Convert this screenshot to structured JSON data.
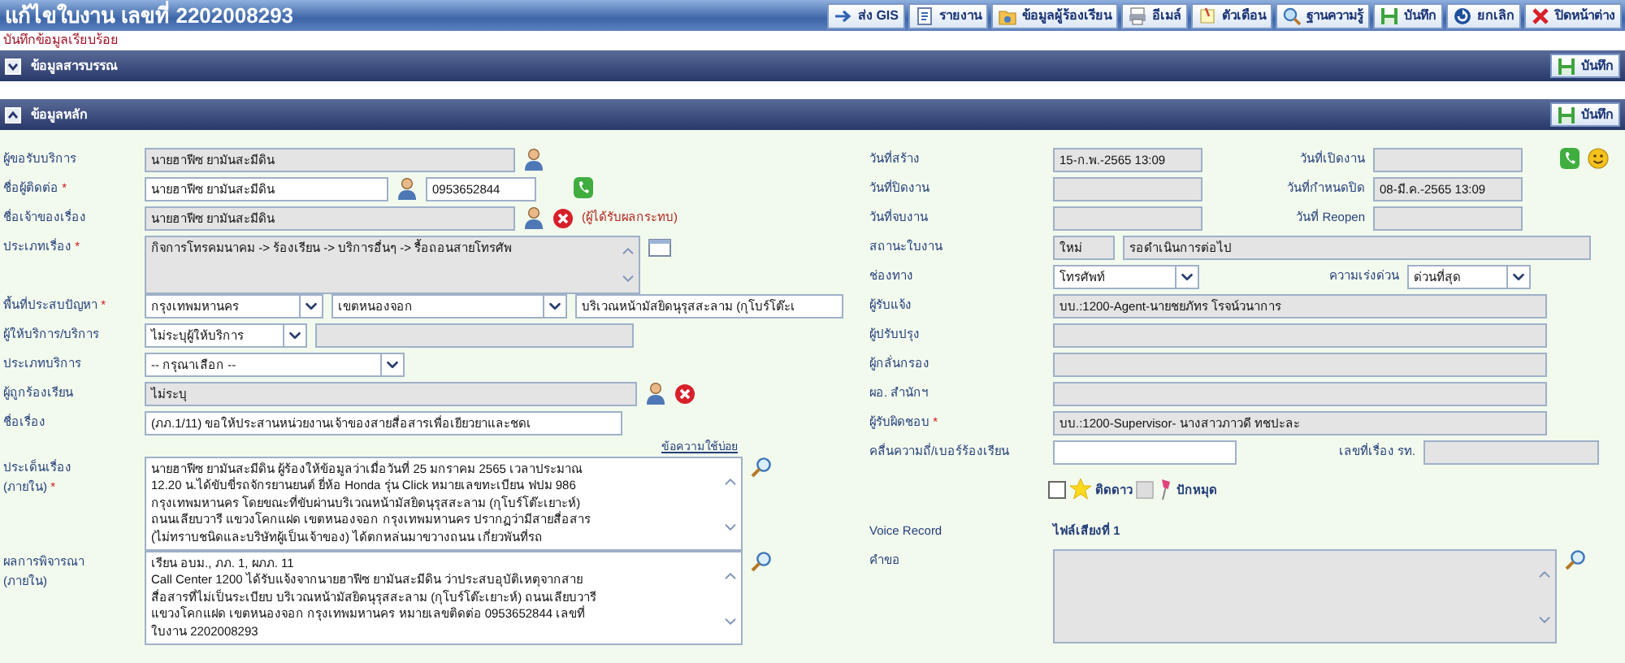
{
  "window": {
    "title": "แก้ไขใบงาน เลขที่ 2202008293"
  },
  "toolbar": [
    "ส่ง GIS",
    "รายงาน",
    "ข้อมูลผู้ร้องเรียน",
    "อีเมล์",
    "ตัวเตือน",
    "ฐานความรู้",
    "บันทึก",
    "ยกเลิก",
    "ปิดหน้าต่าง"
  ],
  "status_message": "บันทึกข้อมูลเรียบร้อย",
  "sections": [
    {
      "title": "ข้อมูลสารบรรณ",
      "expanded": false,
      "save_label": "บันทึก"
    },
    {
      "title": "ข้อมูลหลัก",
      "expanded": true,
      "save_label": "บันทึก"
    }
  ],
  "left": {
    "common_phrases_link": "ข้อความใช้บ่อย",
    "rows": [
      {
        "label": "ผู้ขอรับบริการ",
        "items": [
          {
            "kind": "text",
            "value": "นายฮาฟีซ ยามันสะมีดิน",
            "readonly": true
          },
          {
            "kind": "pick"
          }
        ]
      },
      {
        "label": "ชื่อผู้ติดต่อ",
        "mark": "*",
        "items": [
          {
            "kind": "text",
            "value": "นายฮาฟีซ ยามันสะมีดิน",
            "readonly": false
          },
          {
            "kind": "pick"
          },
          {
            "kind": "text",
            "value": "0953652844",
            "readonly": false
          },
          {
            "kind": "call"
          }
        ]
      },
      {
        "label": "ชื่อเจ้าของเรื่อง",
        "items": [
          {
            "kind": "text",
            "value": "นายฮาฟีซ ยามันสะมีดิน",
            "readonly": true
          },
          {
            "kind": "pick"
          },
          {
            "kind": "clear"
          },
          {
            "kind": "note",
            "text": "(ผู้ได้รับผลกระทบ)"
          }
        ]
      },
      {
        "label": "ประเภทเรื่อง",
        "mark": "*",
        "items": [
          {
            "kind": "textarea",
            "lines": [
              "กิจการโทรคมนาคม -> ร้องเรียน -> บริการอื่นๆ -> รื้อถอนสายโทรศัพ"
            ],
            "readonly": true
          },
          {
            "kind": "browse"
          }
        ]
      },
      {
        "label": "พื้นที่ประสบปัญหา",
        "mark": "*",
        "items": [
          {
            "kind": "select",
            "value": "กรุงเทพมหานคร"
          },
          {
            "kind": "select",
            "value": "เขตหนองจอก"
          },
          {
            "kind": "text",
            "value": "บริเวณหน้ามัสยิดนุรุสสะลาม (กุโบร์โต๊ะเ",
            "readonly": false
          }
        ]
      },
      {
        "label": "ผู้ให้บริการ/บริการ",
        "items": [
          {
            "kind": "select",
            "value": "ไม่ระบุผู้ให้บริการ"
          },
          {
            "kind": "text",
            "readonly": true
          }
        ]
      },
      {
        "label": "ประเภทบริการ",
        "items": [
          {
            "kind": "select",
            "value": "-- กรุณาเลือก --"
          }
        ]
      },
      {
        "label": "ผู้ถูกร้องเรียน",
        "items": [
          {
            "kind": "text",
            "value": "ไม่ระบุ",
            "readonly": true
          },
          {
            "kind": "pick"
          },
          {
            "kind": "clear"
          }
        ]
      },
      {
        "label": "ชื่อเรื่อง",
        "items": [
          {
            "kind": "text",
            "value": "(ภภ.1/11) ขอให้ประสานหน่วยงานเจ้าของสายสื่อสารเพื่อเยียวยาและชดเ",
            "readonly": false
          }
        ]
      },
      {
        "label": "ประเด็นเรื่อง\n(ภายใน)",
        "mark": "*",
        "items": [
          {
            "kind": "textarea",
            "readonly": false,
            "lines": [
              "นายฮาฟีซ ยามันสะมีดิน ผู้ร้องให้ข้อมูลว่าเมื่อวันที่ 25 มกราคม 2565 เวลาประมาณ",
              "12.20 น.ได้ขับขี่รถจักรยานยนต์ ยี่ห้อ Honda รุ่น Click หมายเลขทะเบียน ฟปม 986",
              "กรุงเทพมหานคร โดยขณะที่ขับผ่านบริเวณหน้ามัสยิดนุรุสสะลาม (กุโบร์โต๊ะเยาะห์)",
              "ถนนเลียบวารี แขวงโคกแฝด เขตหนองจอก กรุงเทพมหานคร ปรากฏว่ามีสายสื่อสาร",
              "(ไม่ทราบชนิดและบริษัทผู้เป็นเจ้าของ) ได้ตกหล่นมาขวางถนน เกี่ยวพันที่รถ"
            ]
          },
          {
            "kind": "zoom"
          }
        ]
      },
      {
        "label": "ผลการพิจารณา\n(ภายใน)",
        "items": [
          {
            "kind": "textarea",
            "readonly": false,
            "lines": [
              "เรียน อบม., ภภ. 1, ผภภ. 11",
              "Call Center 1200 ได้รับแจ้งจากนายฮาฟีซ ยามันสะมีดิน ว่าประสบอุบัติเหตุจากสาย",
              "สื่อสารที่ไม่เป็นระเบียบ บริเวณหน้ามัสยิดนุรุสสะลาม (กุโบร์โต๊ะเยาะห์) ถนนเลียบวารี",
              "แขวงโคกแฝด เขตหนองจอก กรุงเทพมหานคร หมายเลขติดต่อ 0953652844 เลขที่",
              "ใบงาน 2202008293"
            ]
          },
          {
            "kind": "zoom"
          }
        ]
      }
    ]
  },
  "right": {
    "rows": [
      {
        "label": "วันที่สร้าง",
        "items": [
          {
            "kind": "text",
            "value": "15-ก.พ.-2565 13:09",
            "readonly": true
          },
          {
            "kind": "label",
            "text": "วันที่เปิดงาน"
          },
          {
            "kind": "text",
            "readonly": true
          },
          {
            "kind": "call"
          },
          {
            "kind": "feedback"
          }
        ]
      },
      {
        "label": "วันที่ปิดงาน",
        "items": [
          {
            "kind": "text",
            "readonly": true
          },
          {
            "kind": "label",
            "text": "วันที่กำหนดปิด"
          },
          {
            "kind": "text",
            "value": "08-มี.ค.-2565 13:09",
            "readonly": true
          }
        ]
      },
      {
        "label": "วันที่จบงาน",
        "items": [
          {
            "kind": "text",
            "readonly": true
          },
          {
            "kind": "label",
            "text": "วันที่ Reopen"
          },
          {
            "kind": "text",
            "readonly": true
          }
        ]
      },
      {
        "label": "สถานะใบงาน",
        "items": [
          {
            "kind": "text",
            "value": "ใหม่",
            "readonly": true
          },
          {
            "kind": "text",
            "value": "รอดำเนินการต่อไป",
            "readonly": true
          }
        ]
      },
      {
        "label": "ช่องทาง",
        "items": [
          {
            "kind": "select",
            "value": "โทรศัพท์"
          },
          {
            "kind": "label",
            "text": "ความเร่งด่วน"
          },
          {
            "kind": "select",
            "value": "ด่วนที่สุด"
          }
        ]
      },
      {
        "label": "ผู้รับแจ้ง",
        "items": [
          {
            "kind": "text",
            "value": "บบ.:1200-Agent-นายชยภัทร โรจน์วนาการ",
            "readonly": true
          }
        ]
      },
      {
        "label": "ผู้ปรับปรุง",
        "items": [
          {
            "kind": "text",
            "readonly": true
          }
        ]
      },
      {
        "label": "ผู้กลั่นกรอง",
        "items": [
          {
            "kind": "text",
            "readonly": true
          }
        ]
      },
      {
        "label": "ผอ. สำนักฯ",
        "items": [
          {
            "kind": "text",
            "readonly": true
          }
        ]
      },
      {
        "label": "ผู้รับผิดชอบ",
        "mark": "*",
        "items": [
          {
            "kind": "text",
            "value": "บบ.:1200-Supervisor- นางสาวภาวดี  ทชปะละ",
            "readonly": true
          }
        ]
      },
      {
        "label": "คลื่นความถี่/เบอร์ร้องเรียน",
        "items": [
          {
            "kind": "text",
            "readonly": false
          },
          {
            "kind": "label",
            "text": "เลขที่เรื่อง รท."
          },
          {
            "kind": "text",
            "readonly": true
          }
        ]
      },
      {
        "items": [
          {
            "kind": "favorite",
            "text": "ติดดาว",
            "checked": false,
            "disabled": false
          },
          {
            "kind": "pin",
            "text": "ปักหมุด",
            "checked": false,
            "disabled": true
          }
        ]
      },
      {
        "label": "Voice Record",
        "items": [
          {
            "kind": "link",
            "text": "ไฟล์เสียงที่ 1"
          }
        ]
      },
      {
        "label": "คำขอ",
        "items": [
          {
            "kind": "textarea",
            "readonly": true
          },
          {
            "kind": "zoom"
          }
        ]
      }
    ]
  }
}
